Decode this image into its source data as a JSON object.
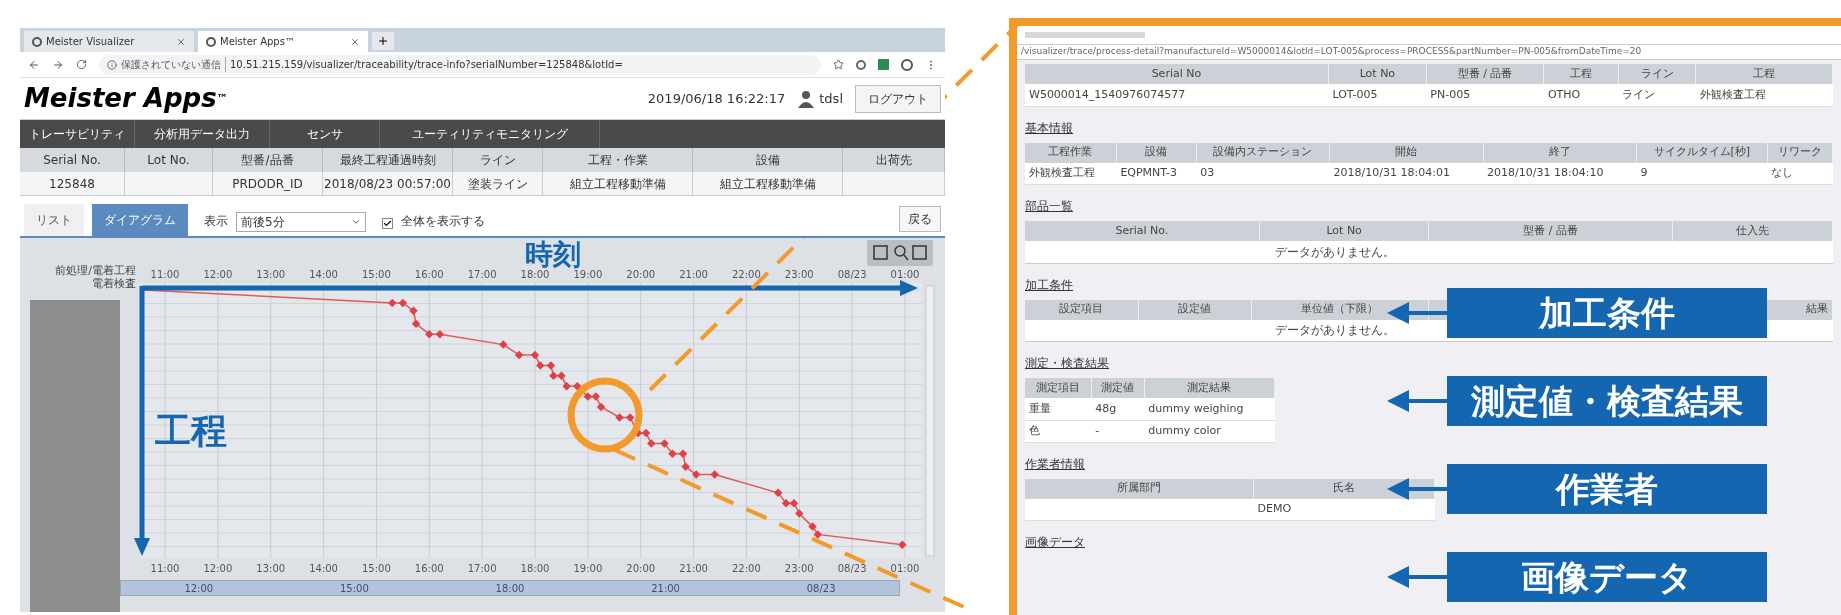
{
  "browser": {
    "tabs": [
      {
        "label": "Meister Visualizer",
        "selected": false
      },
      {
        "label": "Meister Apps™",
        "selected": true
      }
    ],
    "security": "保護されていない通信",
    "url": "10.51.215.159/visualizer/traceability/trace-info?serialNumber=125848&lotId="
  },
  "app": {
    "logo": "Meister Apps",
    "logo_mark": "™",
    "datetime": "2019/06/18 16:22:17",
    "user": "tdsl",
    "logout": "ログアウト",
    "nav": [
      "トレーサビリティ",
      "分析用データ出力",
      "センサ",
      "ユーティリティモニタリング"
    ],
    "summary": {
      "columns": [
        "Serial No.",
        "Lot No.",
        "型番/品番",
        "最終工程通過時刻",
        "ライン",
        "工程・作業",
        "設備",
        "出荷先"
      ],
      "row": {
        "serial_no": "125848",
        "model": "PRDODR_ID",
        "last_time": "2018/08/23 00:57:00",
        "line": "塗装ライン",
        "process": "組立工程移動準備",
        "equipment": "組立工程移動準備"
      }
    },
    "view_tabs": [
      {
        "label": "リスト",
        "selected": false
      },
      {
        "label": "ダイアグラム",
        "selected": true
      }
    ],
    "display_label": "表示",
    "display_select": "前後5分",
    "show_all": {
      "label": "全体を表示する",
      "checked": true
    },
    "back": "戻る"
  },
  "chart": {
    "top_ticks": [
      "11:00",
      "12:00",
      "13:00",
      "14:00",
      "15:00",
      "16:00",
      "17:00",
      "18:00",
      "19:00",
      "20:00",
      "21:00",
      "22:00",
      "23:00",
      "08/23",
      "01:00"
    ],
    "bottom_ticks": [
      "11:00",
      "12:00",
      "13:00",
      "14:00",
      "15:00",
      "16:00",
      "17:00",
      "18:00",
      "19:00",
      "20:00",
      "21:00",
      "22:00",
      "23:00",
      "08/23",
      "01:00"
    ],
    "range_slider": {
      "level": 1
    },
    "y_labels": [
      "前処理/電着工程",
      "電着検査"
    ],
    "range_ticks": [
      "12:00",
      "15:00",
      "18:00",
      "21:00",
      "08/23"
    ]
  },
  "annotations": {
    "time_axis": "時刻",
    "process_axis": "工程"
  },
  "detail": {
    "url": "/visualizer/trace/process-detail?manufactureId=W5000014&lotId=LOT-005&process=PROCESS&partNumber=PN-005&fromDateTime=20",
    "main": {
      "columns": [
        "Serial No",
        "Lot No",
        "型番 / 品番",
        "工程",
        "ライン",
        "工程"
      ],
      "row": [
        "W5000014_1540976074577",
        "LOT-005",
        "PN-005",
        "OTHO",
        "ライン",
        "外観検査工程"
      ]
    },
    "basic": {
      "title": "基本情報",
      "columns": [
        "工程作業",
        "設備",
        "設備内ステーション",
        "開始",
        "終了",
        "サイクルタイム[秒]",
        "リワーク"
      ],
      "row": [
        "外観検査工程",
        "EQPMNT-3",
        "03",
        "2018/10/31 18:04:01",
        "2018/10/31 18:04:10",
        "9",
        "なし"
      ]
    },
    "parts": {
      "title": "部品一覧",
      "columns": [
        "Serial No.",
        "Lot No",
        "型番 / 品番",
        "仕入先"
      ],
      "empty": "データがありません。"
    },
    "conditions": {
      "title": "加工条件",
      "columns": [
        "設定項目",
        "設定値",
        "単位値（下限）",
        "結果"
      ],
      "empty": "データがありません。"
    },
    "measure": {
      "title": "測定・検査結果",
      "columns": [
        "測定項目",
        "測定値",
        "測定結果"
      ],
      "rows": [
        [
          "重量",
          "48g",
          "dummy weighing"
        ],
        [
          "色",
          "-",
          "dummy color"
        ]
      ]
    },
    "workers": {
      "title": "作業者情報",
      "columns": [
        "所属部門",
        "氏名"
      ],
      "row": {
        "name": "DEMO"
      }
    },
    "images": {
      "title": "画像データ"
    }
  },
  "callouts": [
    "加工条件",
    "測定値・検査結果",
    "作業者",
    "画像データ"
  ]
}
